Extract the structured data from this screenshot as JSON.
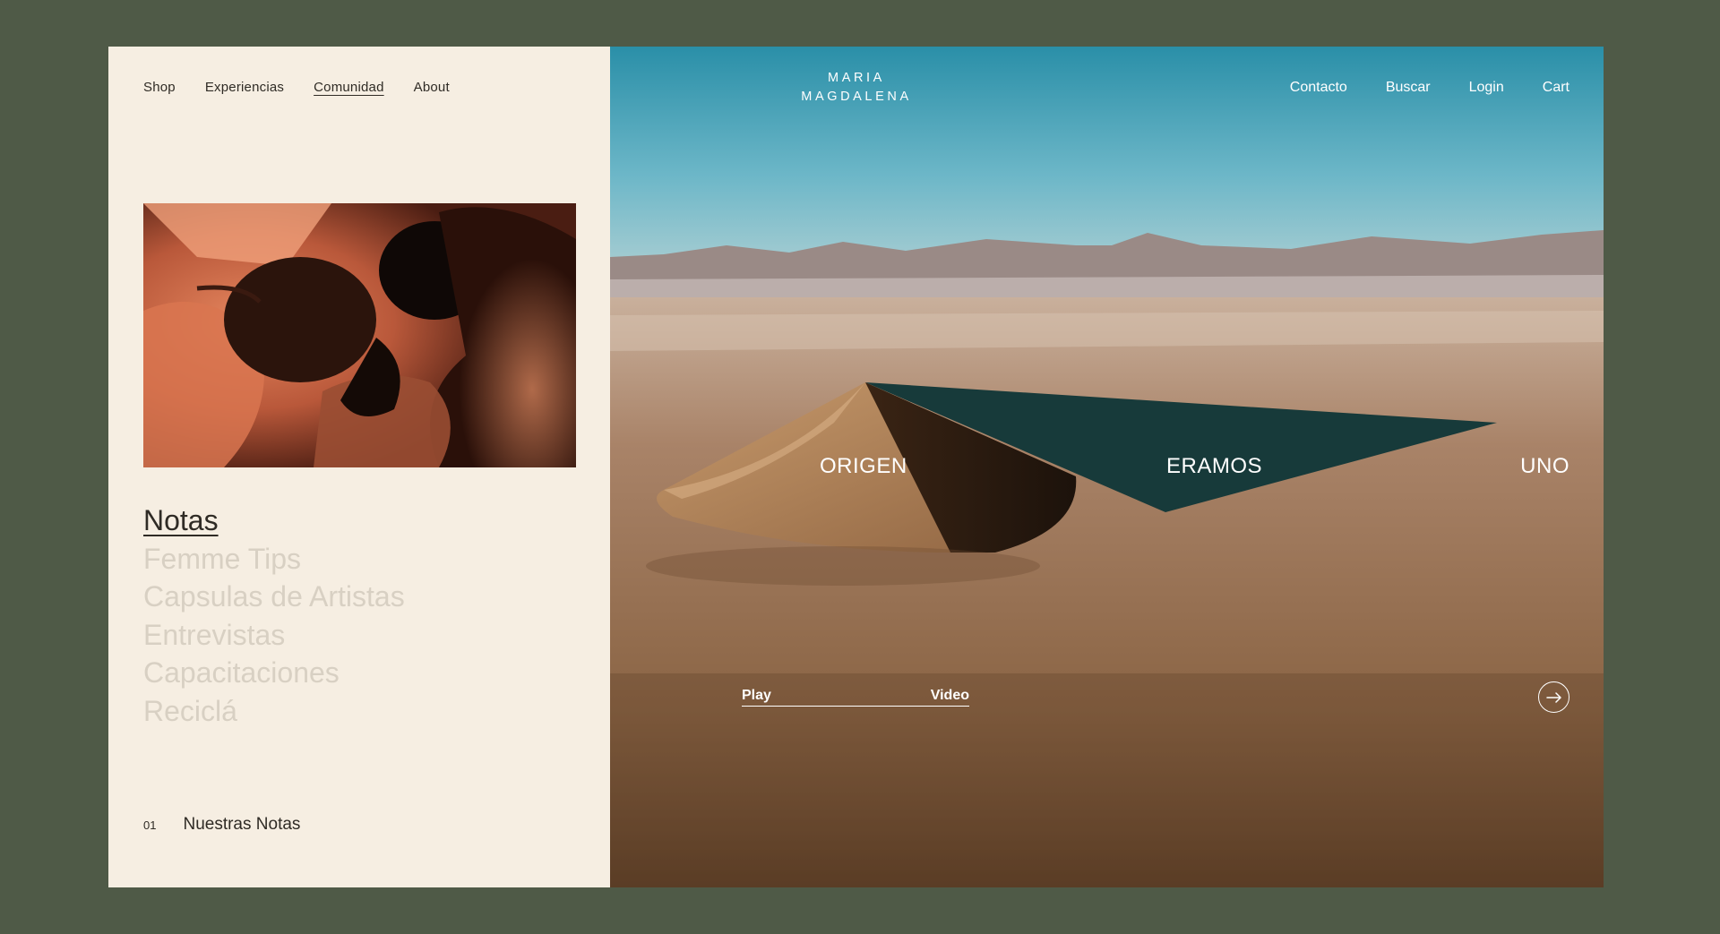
{
  "left_nav": {
    "items": [
      {
        "label": "Shop",
        "active": false
      },
      {
        "label": "Experiencias",
        "active": false
      },
      {
        "label": "Comunidad",
        "active": true
      },
      {
        "label": "About",
        "active": false
      }
    ]
  },
  "categories": {
    "items": [
      {
        "label": "Notas",
        "active": true
      },
      {
        "label": "Femme Tips",
        "active": false
      },
      {
        "label": "Capsulas de Artistas",
        "active": false
      },
      {
        "label": "Entrevistas",
        "active": false
      },
      {
        "label": "Capacitaciones",
        "active": false
      },
      {
        "label": "Reciclá",
        "active": false
      }
    ]
  },
  "footer": {
    "number": "01",
    "label": "Nuestras Notas"
  },
  "logo": {
    "line1": "MARIA",
    "line2": "MAGDALENA"
  },
  "right_nav": {
    "items": [
      "Contacto",
      "Buscar",
      "Login",
      "Cart"
    ]
  },
  "hero": {
    "words": [
      "ORIGEN",
      "ERAMOS",
      "UNO"
    ],
    "play_label": "Play",
    "video_label": "Video",
    "arrow_icon": "arrow-right-icon"
  },
  "colors": {
    "page_bg": "#4f5a47",
    "panel_bg": "#f6eee2",
    "text_dark": "#2f2b25",
    "text_muted": "#d8d0c3",
    "hero_text": "#ffffff"
  }
}
